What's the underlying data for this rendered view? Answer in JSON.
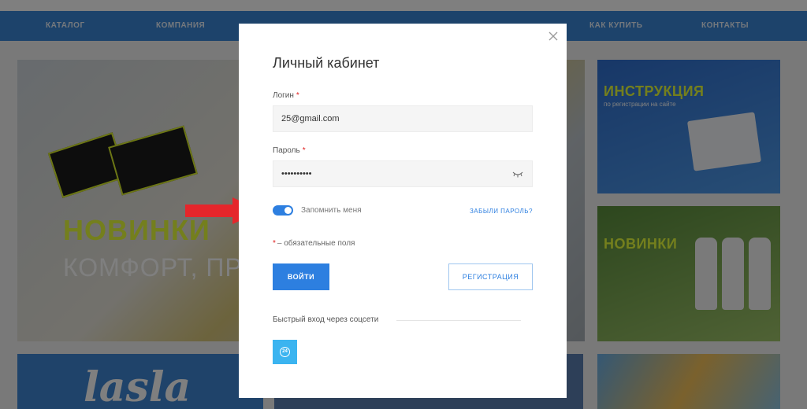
{
  "background": {
    "nav_items": [
      "КАТАЛОГ",
      "КОМПАНИЯ",
      "КАК КУПИТЬ",
      "КОНТАКТЫ"
    ],
    "banner_main": {
      "line1": "НОВИНКИ",
      "line2": "КОМФОРТ, ПРО"
    },
    "banner_right_top": {
      "title": "ИНСТРУКЦИЯ",
      "subtitle": "по регистрации на сайте"
    },
    "banner_right_middle": {
      "title": "НОВИНКИ"
    },
    "banner_bottom_logo": "lasla"
  },
  "modal": {
    "title": "Личный кабинет",
    "login": {
      "label": "Логин",
      "value": "25@gmail.com"
    },
    "password": {
      "label": "Пароль",
      "value": "••••••••••"
    },
    "remember_label": "Запомнить меня",
    "remember_checked": true,
    "forgot_link": "ЗАБЫЛИ ПАРОЛЬ?",
    "required_note": "– обязательные поля",
    "required_star": "*",
    "login_button": "ВОЙТИ",
    "register_button": "РЕГИСТРАЦИЯ",
    "social_label": "Быстрый вход через соцсети",
    "social_buttons": [
      {
        "icon": "bitrix24-icon",
        "text": "24"
      }
    ]
  },
  "colors": {
    "accent": "#2d7fe0",
    "social_b24": "#3bb4f0",
    "required": "#e02020",
    "arrow": "#e5262b"
  }
}
